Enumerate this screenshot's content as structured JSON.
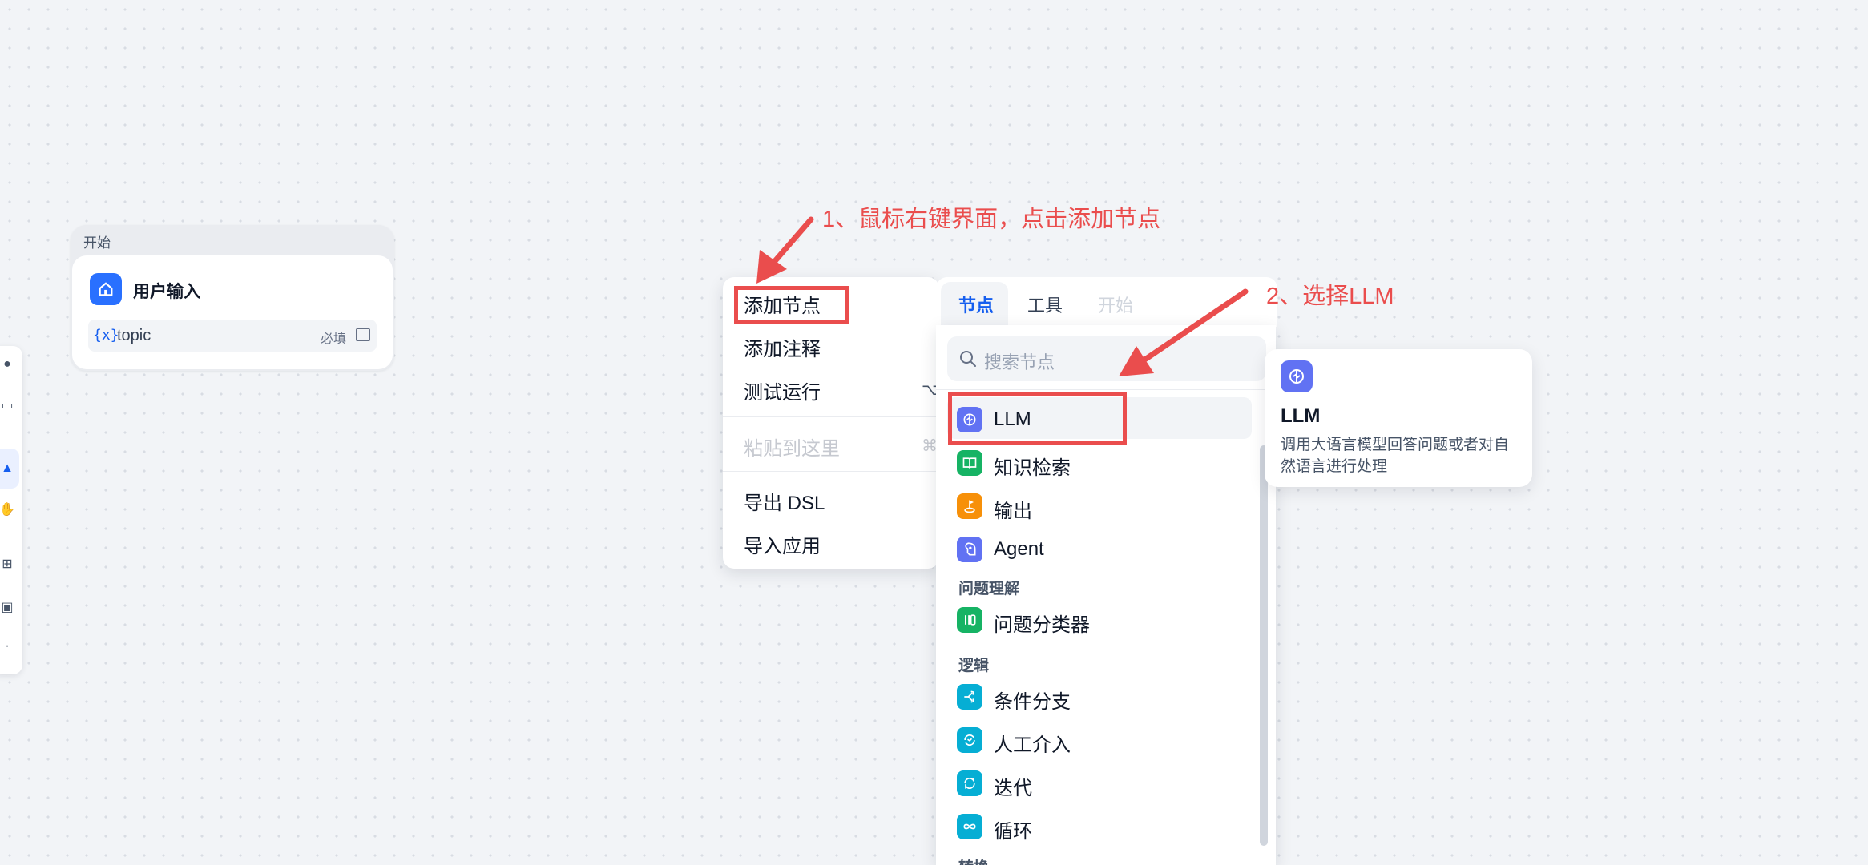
{
  "start_node": {
    "header": "开始",
    "title": "用户输入",
    "variable": {
      "type_glyph": "{x}",
      "name": "topic",
      "required": "必填"
    }
  },
  "context_menu": {
    "items": [
      {
        "label": "添加节点"
      },
      {
        "label": "添加注释"
      },
      {
        "label": "测试运行",
        "shortcut": "⌥"
      },
      {
        "label": "粘贴到这里",
        "shortcut": "⌘",
        "disabled": true
      },
      {
        "label": "导出 DSL"
      },
      {
        "label": "导入应用"
      }
    ]
  },
  "picker": {
    "tabs": [
      "节点",
      "工具",
      "开始"
    ],
    "search_placeholder": "搜索节点",
    "items": [
      {
        "label": "LLM",
        "icon": "brain-icon",
        "color": "#6172f3"
      },
      {
        "label": "知识检索",
        "icon": "book-icon",
        "color": "#16b364"
      },
      {
        "label": "输出",
        "icon": "flag-icon",
        "color": "#f79009"
      },
      {
        "label": "Agent",
        "icon": "agent-icon",
        "color": "#6172f3"
      }
    ],
    "group_understanding": "问题理解",
    "understanding_items": [
      {
        "label": "问题分类器",
        "icon": "classifier-icon",
        "color": "#16b364"
      }
    ],
    "group_logic": "逻辑",
    "logic_items": [
      {
        "label": "条件分支",
        "icon": "branch-icon",
        "color": "#06aed4"
      },
      {
        "label": "人工介入",
        "icon": "human-icon",
        "color": "#06aed4"
      },
      {
        "label": "迭代",
        "icon": "iteration-icon",
        "color": "#06aed4"
      },
      {
        "label": "循环",
        "icon": "loop-icon",
        "color": "#06aed4"
      }
    ],
    "group_partial": "转换"
  },
  "tooltip": {
    "title": "LLM",
    "description": "调用大语言模型回答问题或者对自然语言进行处理"
  },
  "annotations": {
    "step1": "1、鼠标右键界面，点击添加节点",
    "step2": "2、选择LLM"
  },
  "colors": {
    "accent": "#155eef",
    "annotation": "#ea4d4d"
  }
}
